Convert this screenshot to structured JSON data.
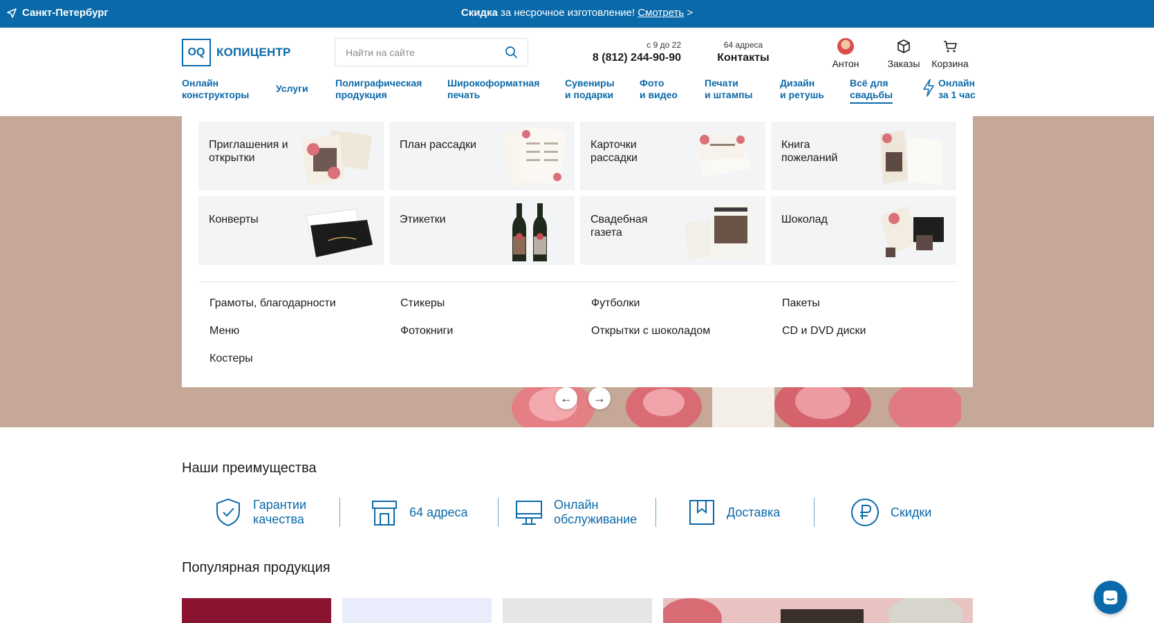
{
  "topbar": {
    "city": "Санкт-Петербург",
    "promo_bold": "Скидка",
    "promo_text": " за несрочное изготовление! ",
    "promo_link": "Смотреть",
    "promo_arrow": " >"
  },
  "header": {
    "logo_mark": "OQ",
    "logo_text": "КОПИЦЕНТР",
    "search_placeholder": "Найти на сайте",
    "hours": "с 9 до 22",
    "phone": "8 (812) 244-90-90",
    "addresses": "64 адреса",
    "contacts": "Контакты",
    "user": "Антон",
    "orders": "Заказы",
    "cart": "Корзина"
  },
  "nav": [
    {
      "l1": "Онлайн",
      "l2": "конструкторы"
    },
    {
      "l1": "Услуги",
      "l2": ""
    },
    {
      "l1": "Полиграфическая",
      "l2": "продукция"
    },
    {
      "l1": "Широкоформатная",
      "l2": "печать"
    },
    {
      "l1": "Сувениры",
      "l2": "и подарки"
    },
    {
      "l1": "Фото",
      "l2": "и видео"
    },
    {
      "l1": "Печати",
      "l2": "и штампы"
    },
    {
      "l1": "Дизайн",
      "l2": "и ретушь"
    },
    {
      "l1": "Всё для",
      "l2": "свадьбы"
    },
    {
      "l1": "Онлайн",
      "l2": "за 1 час"
    }
  ],
  "mega": {
    "cards": [
      {
        "title": "Приглашения и открытки"
      },
      {
        "title": "План рассадки"
      },
      {
        "title": "Карточки рассадки"
      },
      {
        "title": "Книга пожеланий"
      },
      {
        "title": "Конверты"
      },
      {
        "title": "Этикетки"
      },
      {
        "title": "Свадебная газета"
      },
      {
        "title": "Шоколад"
      }
    ],
    "links": [
      "Грамоты, благодарности",
      "Стикеры",
      "Футболки",
      "Пакеты",
      "Меню",
      "Фотокниги",
      "Открытки с шоколадом",
      "CD и DVD диски",
      "Костеры"
    ]
  },
  "slider": {
    "prev": "←",
    "next": "→"
  },
  "advantages": {
    "title": "Наши преимущества",
    "items": [
      {
        "l1": "Гарантии",
        "l2": "качества"
      },
      {
        "l1": "64 адреса",
        "l2": ""
      },
      {
        "l1": "Онлайн",
        "l2": "обслуживание"
      },
      {
        "l1": "Доставка",
        "l2": ""
      },
      {
        "l1": "Скидки",
        "l2": ""
      }
    ]
  },
  "popular": {
    "title": "Популярная продукция"
  },
  "colors": {
    "brand": "#0a69a9",
    "hero": "#c5a898",
    "card": "#f3f4f5"
  }
}
